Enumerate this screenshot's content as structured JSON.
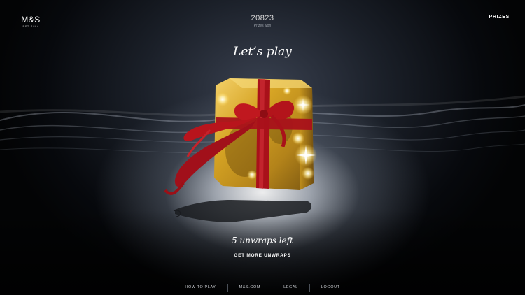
{
  "header": {
    "logo": "M&S",
    "logo_sub": "EST. 1884",
    "counter_value": "20823",
    "counter_label": "Prizes won",
    "prizes_link": "PRIZES"
  },
  "main": {
    "title": "Let’s play",
    "unwraps_left": "5 unwraps left",
    "get_more": "GET MORE UNWRAPS"
  },
  "footer": {
    "links": [
      "HOW TO PLAY",
      "M&S.COM",
      "LEGAL",
      "LOGOUT"
    ]
  },
  "colors": {
    "background": "#05070a",
    "gift_gold": "#d4a21c",
    "ribbon_red": "#b3121c",
    "text": "#ffffff"
  }
}
